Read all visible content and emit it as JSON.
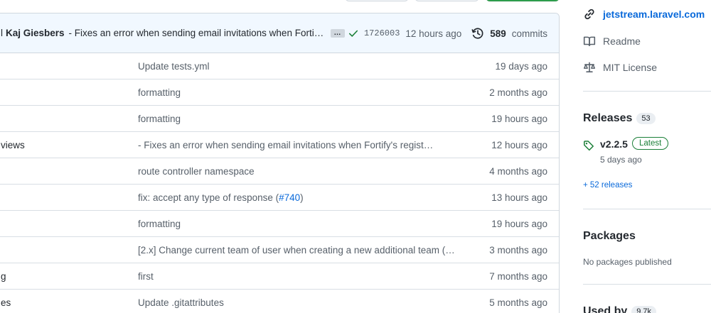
{
  "latest_commit": {
    "prefix": "l",
    "author": "Kaj Giesbers",
    "message": "- Fixes an error when sending email invitations when Fortify's registration feature is disabled",
    "sha": "1726003",
    "time": "12 hours ago",
    "commit_count": "589",
    "commits_label": "commits"
  },
  "files": [
    {
      "name": "",
      "message": "Update tests.yml",
      "time": "19 days ago"
    },
    {
      "name": "",
      "message": "formatting",
      "time": "2 months ago"
    },
    {
      "name": "",
      "message": "formatting",
      "time": "19 hours ago"
    },
    {
      "name": "views",
      "message": "- Fixes an error when sending email invitations when Fortify's regist…",
      "time": "12 hours ago"
    },
    {
      "name": "",
      "message": "route controller namespace",
      "time": "4 months ago"
    },
    {
      "name": "",
      "message_prefix": "fix: accept any type of response (",
      "message_link": "#740",
      "message_suffix": ")",
      "time": "13 hours ago"
    },
    {
      "name": "",
      "message": "formatting",
      "time": "19 hours ago"
    },
    {
      "name": "",
      "message": "[2.x] Change current team of user when creating a new additional team (…",
      "time": "3 months ago"
    },
    {
      "name": "g",
      "message": "first",
      "time": "7 months ago"
    },
    {
      "name": "es",
      "message": "Update .gitattributes",
      "time": "5 months ago"
    }
  ],
  "sidebar": {
    "website": "jetstream.laravel.com",
    "readme": "Readme",
    "license": "MIT License",
    "releases_title": "Releases",
    "releases_count": "53",
    "release_name": "v2.2.5",
    "release_badge": "Latest",
    "release_date": "5 days ago",
    "more_releases": "+ 52 releases",
    "packages_title": "Packages",
    "packages_empty": "No packages published",
    "used_by_title": "Used by",
    "used_by_count": "9.7k"
  },
  "colors": {
    "link": "#0969da",
    "success": "#1a7f37",
    "commit_bar_bg": "#f1f8ff"
  },
  "icons": [
    "check-icon",
    "history-icon",
    "link-icon",
    "book-icon",
    "law-icon",
    "tag-icon"
  ]
}
